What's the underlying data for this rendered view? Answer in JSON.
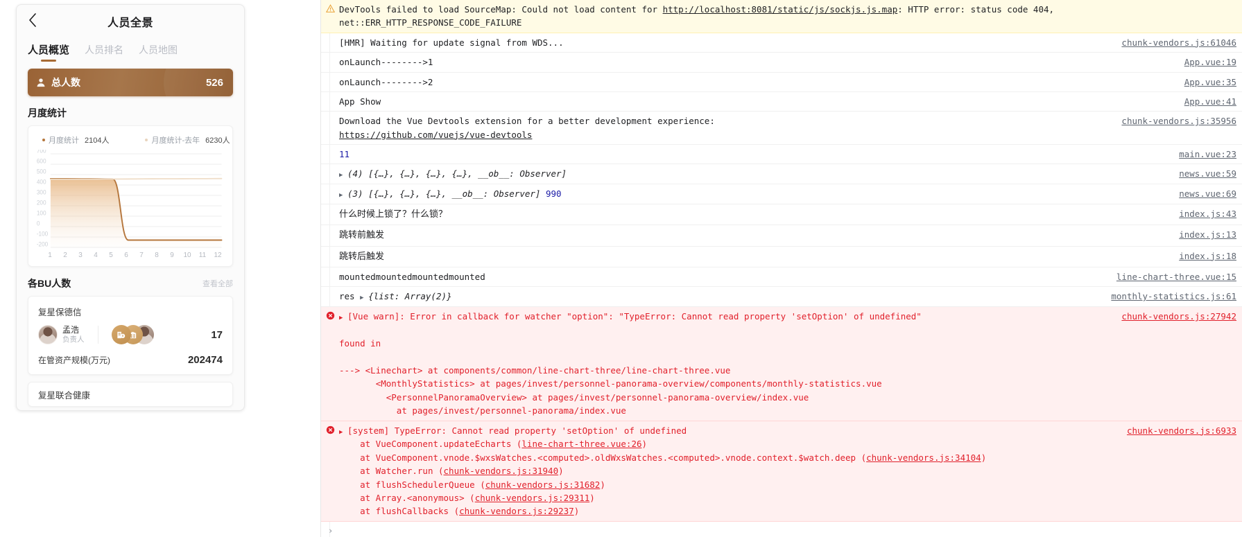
{
  "phone": {
    "nav": {
      "back_icon": "chevron-left-icon",
      "title": "人员全景"
    },
    "tabs": [
      {
        "label": "人员概览",
        "active": true
      },
      {
        "label": "人员排名",
        "active": false
      },
      {
        "label": "人员地图",
        "active": false
      }
    ],
    "total_card": {
      "icon": "person-icon",
      "label": "总人数",
      "value": "526"
    },
    "monthly": {
      "title": "月度统计",
      "legend": [
        {
          "name": "月度统计",
          "value": "2104人",
          "color": "#b5763c"
        },
        {
          "name": "月度统计-去年",
          "value": "6230人",
          "color": "#e8d4bd"
        }
      ]
    },
    "bu": {
      "title": "各BU人数",
      "more_label": "查看全部",
      "card": {
        "name": "复星保德信",
        "owner_name": "孟浩",
        "owner_role": "负责人",
        "count": "17",
        "sub_label": "在管资产规模(万元)",
        "sub_value": "202474"
      },
      "next_card_peek": "复星联合健康"
    }
  },
  "chart_data": {
    "type": "line",
    "title": "月度统计",
    "xlabel": "",
    "ylabel": "",
    "categories": [
      "1",
      "2",
      "3",
      "4",
      "5",
      "6",
      "7",
      "8",
      "9",
      "10",
      "11",
      "12"
    ],
    "ytick_labels": [
      "700",
      "600",
      "500",
      "400",
      "300",
      "200",
      "100",
      "0",
      "-100",
      "-200"
    ],
    "ylim": [
      -200,
      700
    ],
    "grid": true,
    "legend_position": "top-left",
    "series": [
      {
        "name": "月度统计",
        "color": "#b5763c",
        "area": true,
        "values": [
          460,
          460,
          459,
          458,
          457,
          -130,
          -130,
          -130,
          -130,
          -130,
          -130,
          -130
        ]
      },
      {
        "name": "月度统计-去年",
        "color": "#e8d4bd",
        "area": false,
        "values": [
          455,
          455,
          456,
          456,
          457,
          458,
          459,
          460,
          460,
          461,
          461,
          462
        ]
      }
    ]
  },
  "console": {
    "rows": [
      {
        "level": "warn",
        "icon": "warning-icon",
        "source": "",
        "parts": [
          {
            "t": "DevTools failed to load SourceMap: Could not load content for "
          },
          {
            "t": "http://localhost:8081/static/js/sockjs.js.map",
            "k": "link"
          },
          {
            "t": ": HTTP error: status code 404,\nnet::ERR_HTTP_RESPONSE_CODE_FAILURE"
          }
        ]
      },
      {
        "level": "log",
        "source": "chunk-vendors.js:61046",
        "parts": [
          {
            "t": "[HMR] Waiting for update signal from WDS..."
          }
        ]
      },
      {
        "level": "log",
        "source": "App.vue:19",
        "parts": [
          {
            "t": "onLaunch-------->1"
          }
        ]
      },
      {
        "level": "log",
        "source": "App.vue:35",
        "parts": [
          {
            "t": "onLaunch-------->2"
          }
        ]
      },
      {
        "level": "log",
        "source": "App.vue:41",
        "parts": [
          {
            "t": "App Show"
          }
        ]
      },
      {
        "level": "log",
        "source": "chunk-vendors.js:35956",
        "parts": [
          {
            "t": "Download the Vue Devtools extension for a better development experience:\n"
          },
          {
            "t": "https://github.com/vuejs/vue-devtools",
            "k": "link"
          }
        ]
      },
      {
        "level": "log",
        "source": "main.vue:23",
        "parts": [
          {
            "t": "11",
            "k": "blue"
          }
        ]
      },
      {
        "level": "log",
        "source": "news.vue:59",
        "expand": true,
        "parts": [
          {
            "t": "(4) [{…}, {…}, {…}, {…}, __ob__: Observer]",
            "k": "ital"
          }
        ]
      },
      {
        "level": "log",
        "source": "news.vue:69",
        "expand": true,
        "parts": [
          {
            "t": "(3) [{…}, {…}, {…}, __ob__: Observer]",
            "k": "ital"
          },
          {
            "t": " 990",
            "k": "blue"
          }
        ]
      },
      {
        "level": "log",
        "source": "index.js:43",
        "parts": [
          {
            "t": "什么时候上锁了？什么锁？",
            "k": "cn"
          }
        ]
      },
      {
        "level": "log",
        "source": "index.js:13",
        "parts": [
          {
            "t": "跳转前触发",
            "k": "cn"
          }
        ]
      },
      {
        "level": "log",
        "source": "index.js:18",
        "parts": [
          {
            "t": "跳转后触发",
            "k": "cn"
          }
        ]
      },
      {
        "level": "log",
        "source": "line-chart-three.vue:15",
        "parts": [
          {
            "t": "mountedmountedmountedmounted"
          }
        ]
      },
      {
        "level": "log",
        "source": "monthly-statistics.js:61",
        "parts": [
          {
            "t": "res "
          },
          {
            "t": "▶",
            "k": "tri"
          },
          {
            "t": "{list: Array(2)}",
            "k": "ital"
          }
        ]
      },
      {
        "level": "error",
        "icon": "error-icon",
        "source": "chunk-vendors.js:27942",
        "expand": true,
        "parts": [
          {
            "t": "[Vue warn]: Error in callback for watcher \"option\": \"TypeError: Cannot read property 'setOption' of undefined\"\n\nfound in\n\n---> <Linechart> at components/common/line-chart-three/line-chart-three.vue\n       <MonthlyStatistics> at pages/invest/personnel-panorama-overview/components/monthly-statistics.vue\n         <PersonnelPanoramaOverview> at pages/invest/personnel-panorama-overview/index.vue\n           at pages/invest/personnel-panorama/index.vue"
          }
        ]
      },
      {
        "level": "error",
        "icon": "error-icon",
        "source": "chunk-vendors.js:6933",
        "expand": true,
        "parts": [
          {
            "t": "[system] TypeError: Cannot read property 'setOption' of undefined\n    at VueComponent.updateEcharts ("
          },
          {
            "t": "line-chart-three.vue:26",
            "k": "link"
          },
          {
            "t": ")\n    at VueComponent.vnode.$wxsWatches.<computed>.oldWxsWatches.<computed>.vnode.context.$watch.deep ("
          },
          {
            "t": "chunk-vendors.js:34104",
            "k": "link"
          },
          {
            "t": ")\n    at Watcher.run ("
          },
          {
            "t": "chunk-vendors.js:31940",
            "k": "link"
          },
          {
            "t": ")\n    at flushSchedulerQueue ("
          },
          {
            "t": "chunk-vendors.js:31682",
            "k": "link"
          },
          {
            "t": ")\n    at Array.<anonymous> ("
          },
          {
            "t": "chunk-vendors.js:29311",
            "k": "link"
          },
          {
            "t": ")\n    at flushCallbacks ("
          },
          {
            "t": "chunk-vendors.js:29237",
            "k": "link"
          },
          {
            "t": ")"
          }
        ]
      }
    ],
    "prompt": {
      "chevron": "›",
      "value": ""
    }
  }
}
